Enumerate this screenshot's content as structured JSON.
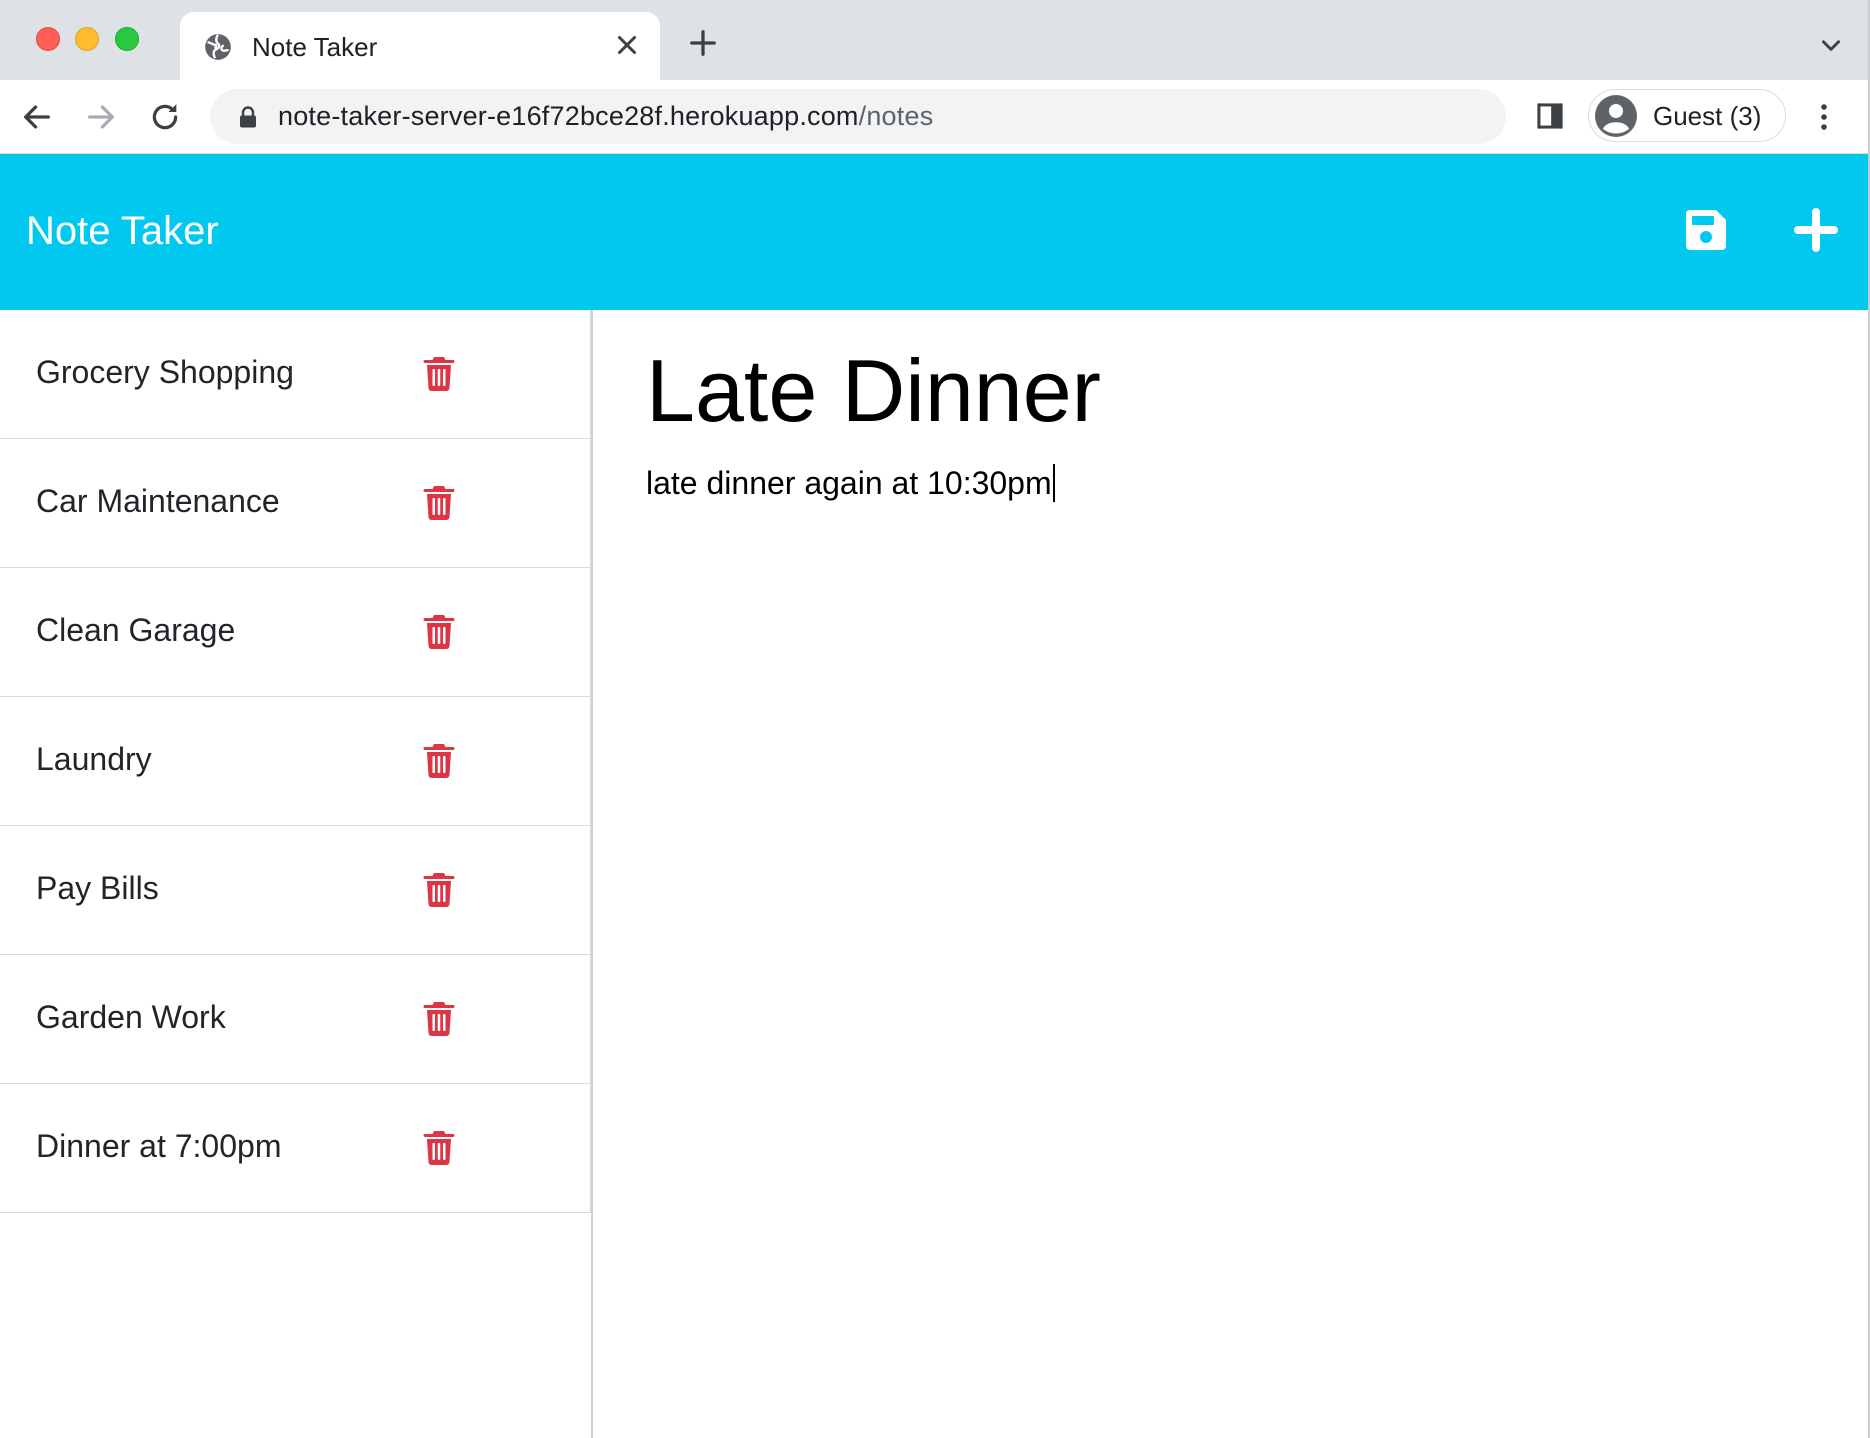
{
  "browser": {
    "tab_title": "Note Taker",
    "url_host": "note-taker-server-e16f72bce28f.herokuapp.com",
    "url_path": "/notes",
    "profile_label": "Guest (3)",
    "icons": [
      "globe-icon",
      "close-icon",
      "plus-icon",
      "chevron-down-icon",
      "back-arrow-icon",
      "forward-arrow-icon",
      "reload-icon",
      "lock-icon",
      "side-panel-icon",
      "avatar-icon",
      "more-vert-icon"
    ]
  },
  "app": {
    "brand": "Note Taker",
    "accent_color": "#00c8ef",
    "delete_color": "#dc3545",
    "icons": [
      "save-icon",
      "plus-icon",
      "trash-icon"
    ]
  },
  "notes": [
    {
      "title": "Grocery Shopping"
    },
    {
      "title": "Car Maintenance"
    },
    {
      "title": "Clean Garage"
    },
    {
      "title": "Laundry"
    },
    {
      "title": "Pay Bills"
    },
    {
      "title": "Garden Work"
    },
    {
      "title": "Dinner at 7:00pm"
    }
  ],
  "active_note": {
    "title": "Late Dinner",
    "text": "late dinner again at 10:30pm"
  }
}
